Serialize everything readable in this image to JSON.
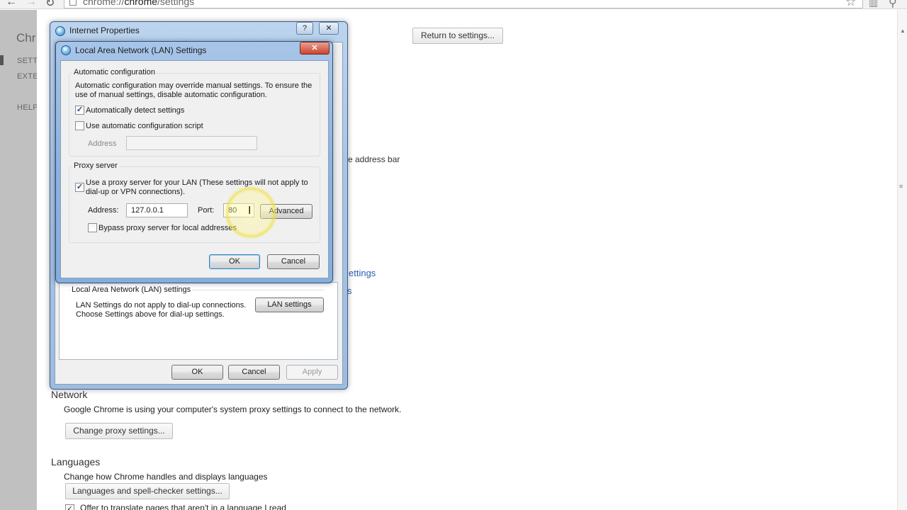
{
  "browser": {
    "url_prefix": "chrome://",
    "url_host": "chrome",
    "url_suffix": "/settings"
  },
  "left_nav": {
    "brand": "Chr",
    "items": [
      "SETT",
      "EXTE",
      "HELP"
    ]
  },
  "settings": {
    "return_button": "Return to settings...",
    "address_bar_fragment": "e address bar",
    "settings_link_fragment": "ettings",
    "settings_link_fragment2": "s",
    "network_heading": "Network",
    "network_desc": "Google Chrome is using your computer's system proxy settings to connect to the network.",
    "change_proxy_button": "Change proxy settings...",
    "languages_heading": "Languages",
    "languages_desc": "Change how Chrome handles and displays languages",
    "languages_button": "Languages and spell-checker settings...",
    "translate_option": "Offer to translate pages that aren't in a language I read"
  },
  "internet_properties": {
    "title": "Internet Properties",
    "help_btn": "?",
    "close_btn": "✕",
    "lan_group_label": "Local Area Network (LAN) settings",
    "lan_desc_line1": "LAN Settings do not apply to dial-up connections.",
    "lan_desc_line2": "Choose Settings above for dial-up settings.",
    "lan_settings_button": "LAN settings",
    "ok": "OK",
    "cancel": "Cancel",
    "apply": "Apply"
  },
  "lan_dialog": {
    "title": "Local Area Network (LAN) Settings",
    "close_btn": "✕",
    "auto_group_label": "Automatic configuration",
    "auto_desc_line1": "Automatic configuration may override manual settings.  To ensure the",
    "auto_desc_line2": "use of manual settings, disable automatic configuration.",
    "auto_detect_label": "Automatically detect settings",
    "auto_detect_checked": true,
    "use_script_label": "Use automatic configuration script",
    "use_script_checked": false,
    "script_address_label": "Address",
    "script_address_value": "",
    "proxy_group_label": "Proxy server",
    "use_proxy_label_line1": "Use a proxy server for your LAN (These settings will not apply to",
    "use_proxy_label_line2": "dial-up or VPN connections).",
    "use_proxy_checked": true,
    "address_label": "Address:",
    "address_value": "127.0.0.1",
    "port_label": "Port:",
    "port_value": "80",
    "advanced_button": "Advanced",
    "bypass_label": "Bypass proxy server for local addresses",
    "bypass_checked": false,
    "ok": "OK",
    "cancel": "Cancel"
  },
  "check_glyph": "✓"
}
